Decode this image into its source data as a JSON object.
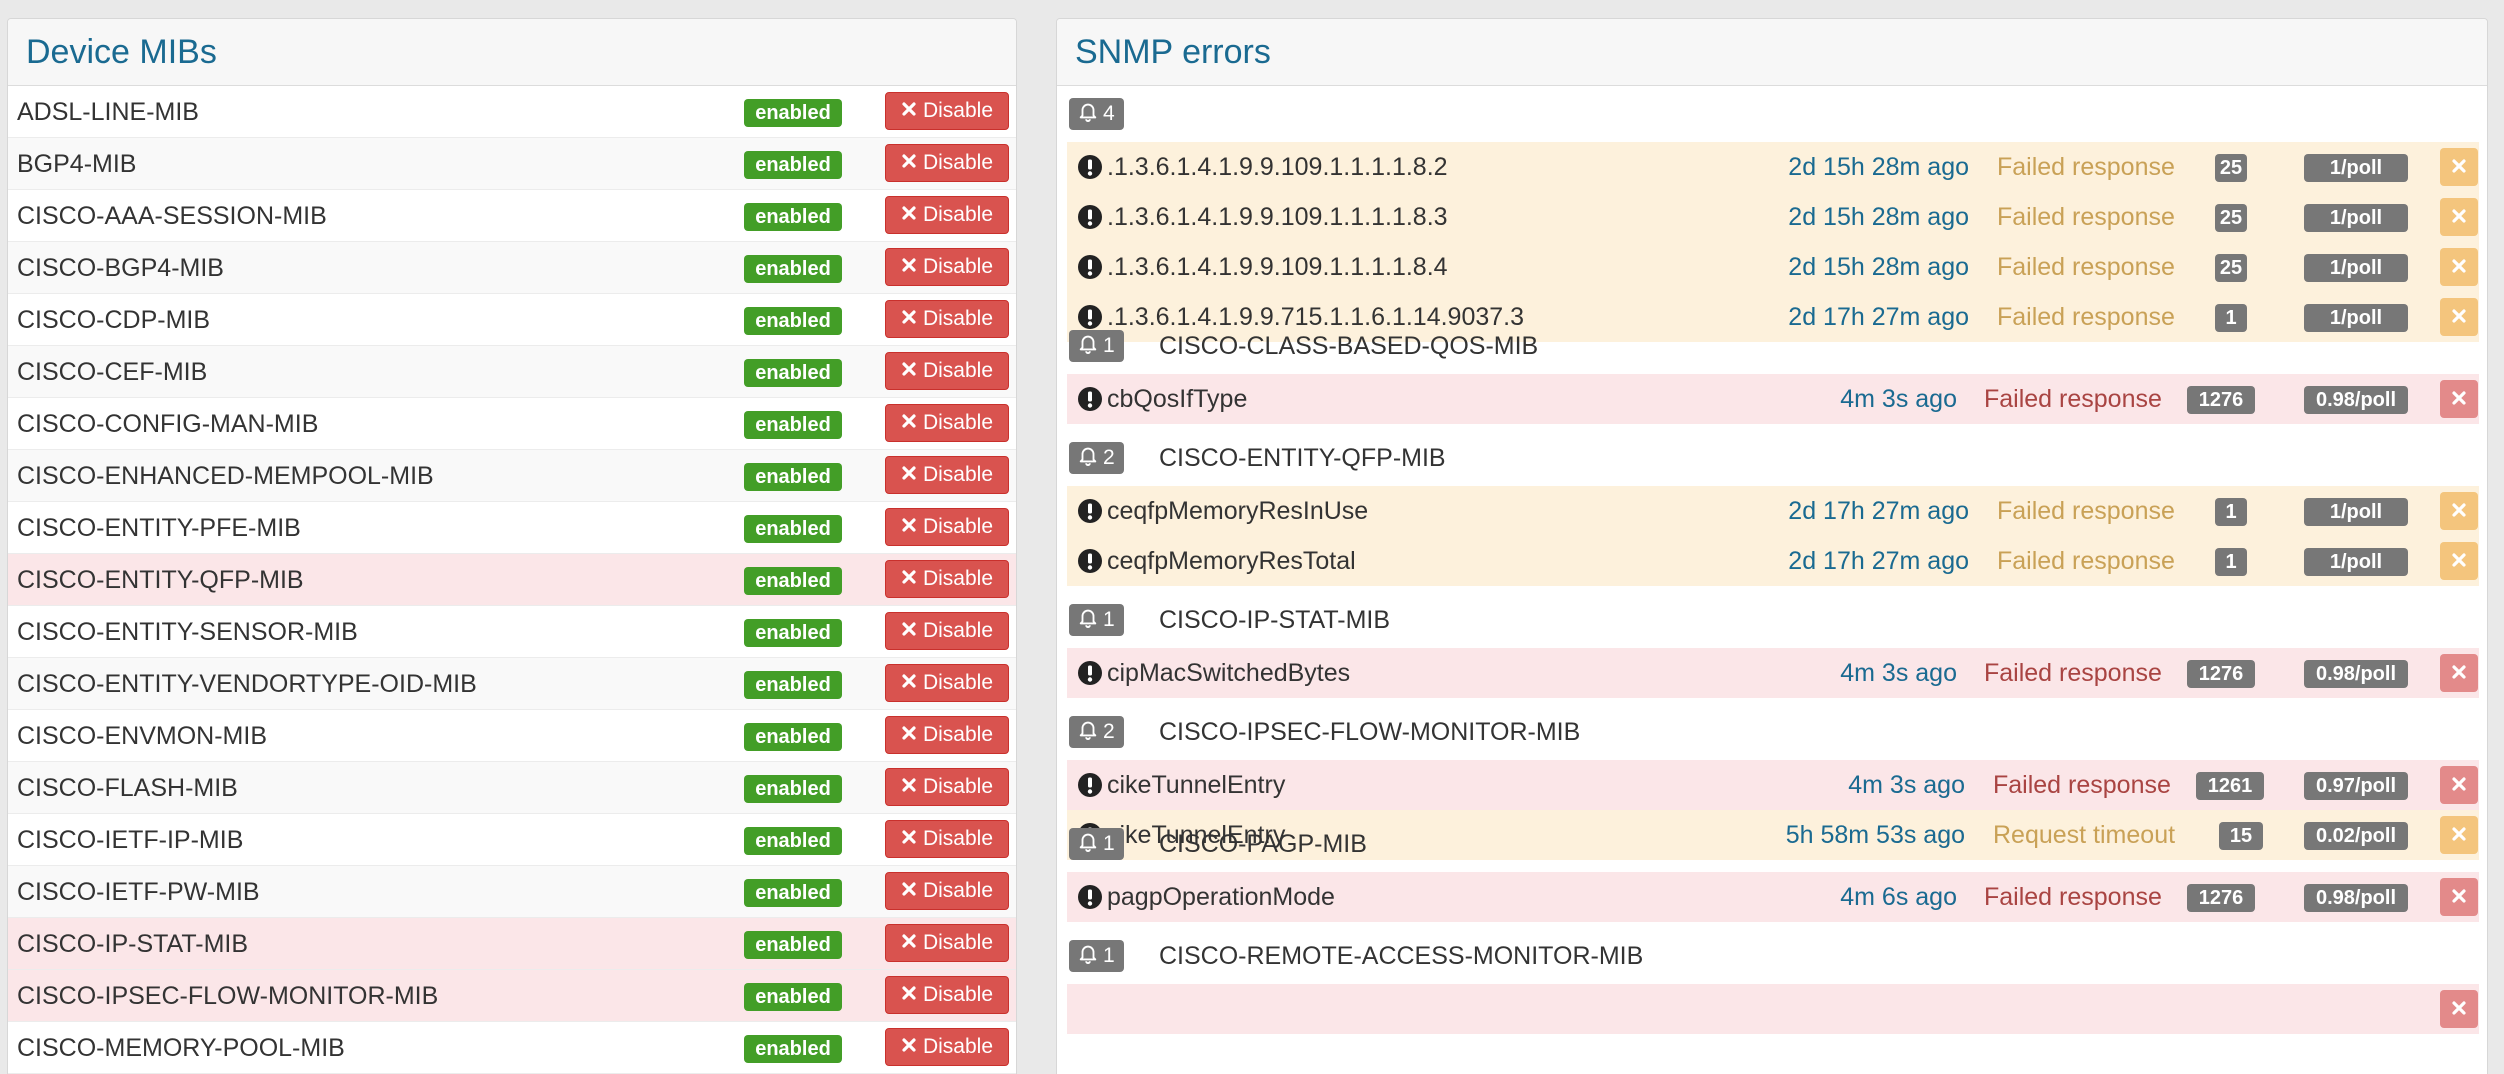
{
  "mibs_panel": {
    "title": "Device MIBs",
    "enabled_label": "enabled",
    "disable_label": "Disable",
    "items": [
      {
        "name": "ADSL-LINE-MIB",
        "error": false
      },
      {
        "name": "BGP4-MIB",
        "error": false
      },
      {
        "name": "CISCO-AAA-SESSION-MIB",
        "error": false
      },
      {
        "name": "CISCO-BGP4-MIB",
        "error": false
      },
      {
        "name": "CISCO-CDP-MIB",
        "error": false
      },
      {
        "name": "CISCO-CEF-MIB",
        "error": false
      },
      {
        "name": "CISCO-CONFIG-MAN-MIB",
        "error": false
      },
      {
        "name": "CISCO-ENHANCED-MEMPOOL-MIB",
        "error": false
      },
      {
        "name": "CISCO-ENTITY-PFE-MIB",
        "error": false
      },
      {
        "name": "CISCO-ENTITY-QFP-MIB",
        "error": true
      },
      {
        "name": "CISCO-ENTITY-SENSOR-MIB",
        "error": false
      },
      {
        "name": "CISCO-ENTITY-VENDORTYPE-OID-MIB",
        "error": false
      },
      {
        "name": "CISCO-ENVMON-MIB",
        "error": false
      },
      {
        "name": "CISCO-FLASH-MIB",
        "error": false
      },
      {
        "name": "CISCO-IETF-IP-MIB",
        "error": false
      },
      {
        "name": "CISCO-IETF-PW-MIB",
        "error": false
      },
      {
        "name": "CISCO-IP-STAT-MIB",
        "error": true
      },
      {
        "name": "CISCO-IPSEC-FLOW-MONITOR-MIB",
        "error": true
      },
      {
        "name": "CISCO-MEMORY-POOL-MIB",
        "error": false
      }
    ]
  },
  "errors_panel": {
    "title": "SNMP errors",
    "groups": [
      {
        "count": "4",
        "title": "",
        "rows": [
          {
            "oid": ".1.3.6.1.4.1.9.9.109.1.1.1.1.8.2",
            "time": "2d 15h 28m ago",
            "status": "Failed response",
            "count": "25",
            "rate": "1/poll",
            "level": "warning"
          },
          {
            "oid": ".1.3.6.1.4.1.9.9.109.1.1.1.1.8.3",
            "time": "2d 15h 28m ago",
            "status": "Failed response",
            "count": "25",
            "rate": "1/poll",
            "level": "warning"
          },
          {
            "oid": ".1.3.6.1.4.1.9.9.109.1.1.1.1.8.4",
            "time": "2d 15h 28m ago",
            "status": "Failed response",
            "count": "25",
            "rate": "1/poll",
            "level": "warning"
          },
          {
            "oid": ".1.3.6.1.4.1.9.9.715.1.1.6.1.14.9037.3",
            "time": "2d 17h 27m ago",
            "status": "Failed response",
            "count": "1",
            "rate": "1/poll",
            "level": "warning"
          }
        ]
      },
      {
        "count": "1",
        "title": "CISCO-CLASS-BASED-QOS-MIB",
        "rows": [
          {
            "oid": "cbQosIfType",
            "time": "4m 3s ago",
            "status": "Failed response",
            "count": "1276",
            "rate": "0.98/poll",
            "level": "danger"
          }
        ]
      },
      {
        "count": "2",
        "title": "CISCO-ENTITY-QFP-MIB",
        "rows": [
          {
            "oid": "ceqfpMemoryResInUse",
            "time": "2d 17h 27m ago",
            "status": "Failed response",
            "count": "1",
            "rate": "1/poll",
            "level": "warning"
          },
          {
            "oid": "ceqfpMemoryResTotal",
            "time": "2d 17h 27m ago",
            "status": "Failed response",
            "count": "1",
            "rate": "1/poll",
            "level": "warning"
          }
        ]
      },
      {
        "count": "1",
        "title": "CISCO-IP-STAT-MIB",
        "rows": [
          {
            "oid": "cipMacSwitchedBytes",
            "time": "4m 3s ago",
            "status": "Failed response",
            "count": "1276",
            "rate": "0.98/poll",
            "level": "danger"
          }
        ]
      },
      {
        "count": "2",
        "title": "CISCO-IPSEC-FLOW-MONITOR-MIB",
        "rows": [
          {
            "oid": "cikeTunnelEntry",
            "time": "4m 3s ago",
            "status": "Failed response",
            "count": "1261",
            "rate": "0.97/poll",
            "level": "danger"
          },
          {
            "oid": "cikeTunnelEntry",
            "time": "5h 58m 53s ago",
            "status": "Request timeout",
            "count": "15",
            "rate": "0.02/poll",
            "level": "warning"
          }
        ]
      },
      {
        "count": "1",
        "title": "CISCO-PAGP-MIB",
        "rows": [
          {
            "oid": "pagpOperationMode",
            "time": "4m 6s ago",
            "status": "Failed response",
            "count": "1276",
            "rate": "0.98/poll",
            "level": "danger"
          }
        ]
      },
      {
        "count": "1",
        "title": "CISCO-REMOTE-ACCESS-MONITOR-MIB",
        "rows": [
          {
            "oid": "",
            "time": "",
            "status": "",
            "count": "",
            "rate": "",
            "level": "danger"
          }
        ]
      }
    ]
  }
}
